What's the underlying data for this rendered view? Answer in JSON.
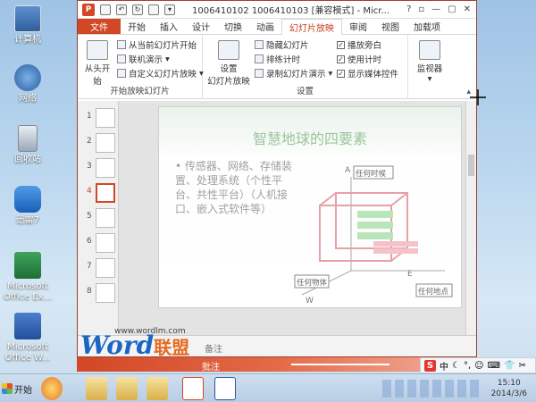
{
  "desktop": {
    "icons": [
      {
        "label": "计算机"
      },
      {
        "label": "网络"
      },
      {
        "label": "回收站"
      },
      {
        "label": "迅雷7"
      },
      {
        "label": "Microsoft Office Ex..."
      },
      {
        "label": "Microsoft Office W..."
      }
    ]
  },
  "window": {
    "title": "1006410102 1006410103 [兼容模式] - Micr...",
    "app_icon": "P",
    "controls": [
      "?",
      "▫",
      "—",
      "▢",
      "✕"
    ],
    "tabs": [
      {
        "label": "文件"
      },
      {
        "label": "开始"
      },
      {
        "label": "插入"
      },
      {
        "label": "设计"
      },
      {
        "label": "切换"
      },
      {
        "label": "动画"
      },
      {
        "label": "幻灯片放映"
      },
      {
        "label": "审阅"
      },
      {
        "label": "视图"
      },
      {
        "label": "加载项"
      }
    ],
    "active_tab": "幻灯片放映"
  },
  "ribbon": {
    "group1": {
      "name": "开始放映幻灯片",
      "from_start": "从头开始",
      "from_current": "从当前幻灯片开始",
      "online": "联机演示",
      "custom": "自定义幻灯片放映"
    },
    "group2": {
      "name": "设置",
      "setup_line1": "设置",
      "setup_line2": "幻灯片放映",
      "hide": "隐藏幻灯片",
      "rehearse": "排练计时",
      "record": "录制幻灯片演示",
      "narration": "播放旁白",
      "use_timing": "使用计时",
      "show_media": "显示媒体控件"
    },
    "group3": {
      "monitor": "监视器"
    }
  },
  "thumbnails": [
    "1",
    "2",
    "3",
    "4",
    "5",
    "6",
    "7",
    "8"
  ],
  "selected_thumbnail": 4,
  "slide": {
    "title": "智慧地球的四要素",
    "body": "• 传感器、网络、存储装置、处理系统（个性平台、共性平台）（人机接口、嵌入式软件等）",
    "diagram": {
      "axis_a": "A",
      "axis_e": "E",
      "axis_w": "W",
      "label_anytime": "任何时候",
      "label_anyplace": "任何地点",
      "label_anything": "任何物体"
    }
  },
  "notes": {
    "placeholder": "备注",
    "comment": "批注"
  },
  "logo": {
    "word": "Word",
    "lianmeng": "联盟",
    "url": "www.wordlm.com"
  },
  "sogou": {
    "s": "S",
    "mode": "中"
  },
  "taskbar": {
    "start": "开始",
    "time": "15:10",
    "date": "2014/3/6"
  },
  "colors": {
    "accent": "#d24726",
    "slide_title": "#9bc49d"
  }
}
